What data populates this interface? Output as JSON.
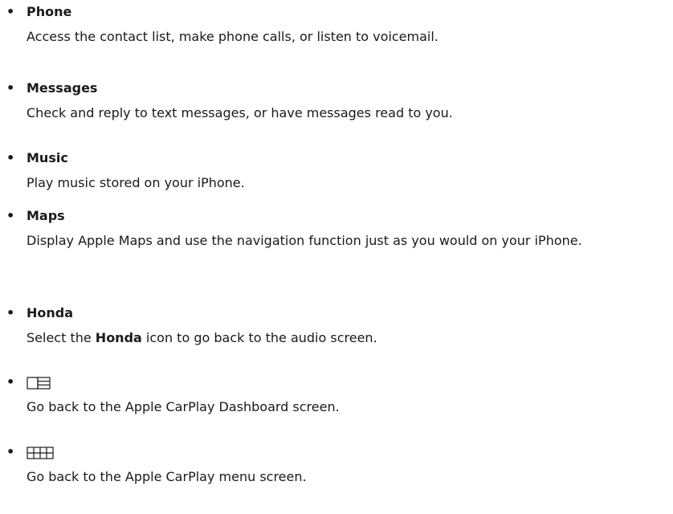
{
  "items": [
    {
      "title": "Phone",
      "desc": "Access the contact list, make phone calls, or listen to voicemail."
    },
    {
      "title": "Messages",
      "desc": "Check and reply to text messages, or have messages read to you."
    },
    {
      "title": "Music",
      "desc": "Play music stored on your iPhone."
    },
    {
      "title": "Maps",
      "desc": "Display Apple Maps and use the navigation function just as you would on your iPhone."
    },
    {
      "title": "Honda",
      "desc_before": "Select the ",
      "desc_bold": "Honda",
      "desc_after": " icon to go back to the audio screen."
    },
    {
      "icon": "dashboard-icon",
      "desc": "Go back to the Apple CarPlay Dashboard screen."
    },
    {
      "icon": "menu-grid-icon",
      "desc": "Go back to the Apple CarPlay menu screen."
    }
  ],
  "bullet": "•"
}
